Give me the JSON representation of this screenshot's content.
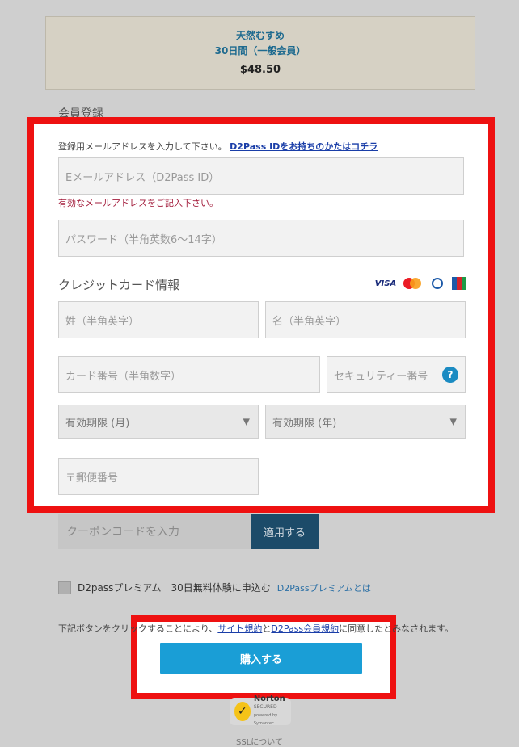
{
  "plan": {
    "name": "天然むすめ",
    "term": "30日間（一般会員）",
    "price": "$48.50"
  },
  "section_title": "会員登録",
  "form": {
    "email_hint": "登録用メールアドレスを入力して下さい。",
    "email_hint_link": "D2Pass IDをお持ちのかたはコチラ",
    "email_placeholder": "Eメールアドレス（D2Pass ID）",
    "email_error": "有効なメールアドレスをご記入下さい。",
    "password_placeholder": "パスワード（半角英数6〜14字）",
    "credit_card_title": "クレジットカード情報",
    "card_logos": [
      "VISA",
      "Mastercard",
      "Diners Club",
      "JCB"
    ],
    "last_name_placeholder": "姓（半角英字）",
    "first_name_placeholder": "名（半角英字）",
    "card_number_placeholder": "カード番号（半角数字）",
    "security_code_placeholder": "セキュリティー番号",
    "security_help": "?",
    "expiry_month": "有効期限 (月)",
    "expiry_year": "有効期限 (年)",
    "postal_placeholder": "〒郵便番号"
  },
  "coupon": {
    "placeholder": "クーポンコードを入力",
    "apply": "適用する"
  },
  "premium": {
    "label": "D2passプレミアム　30日無料体験に申込む",
    "link": "D2Passプレミアムとは"
  },
  "terms": {
    "prefix": "下記ボタンをクリックすることにより、",
    "site_terms": "サイト規約",
    "and": "と",
    "member_terms": "D2Pass会員規約",
    "suffix": "に同意したとみなされます。"
  },
  "purchase_button": "購入する",
  "norton": {
    "title": "Norton",
    "secured": "SECURED",
    "by": "powered by Symantec"
  },
  "ssl_about": "SSLについて",
  "colors": {
    "highlight": "#ee1111",
    "button": "#1a9ed6",
    "link": "#1a3ea8",
    "error": "#a31d3c"
  }
}
